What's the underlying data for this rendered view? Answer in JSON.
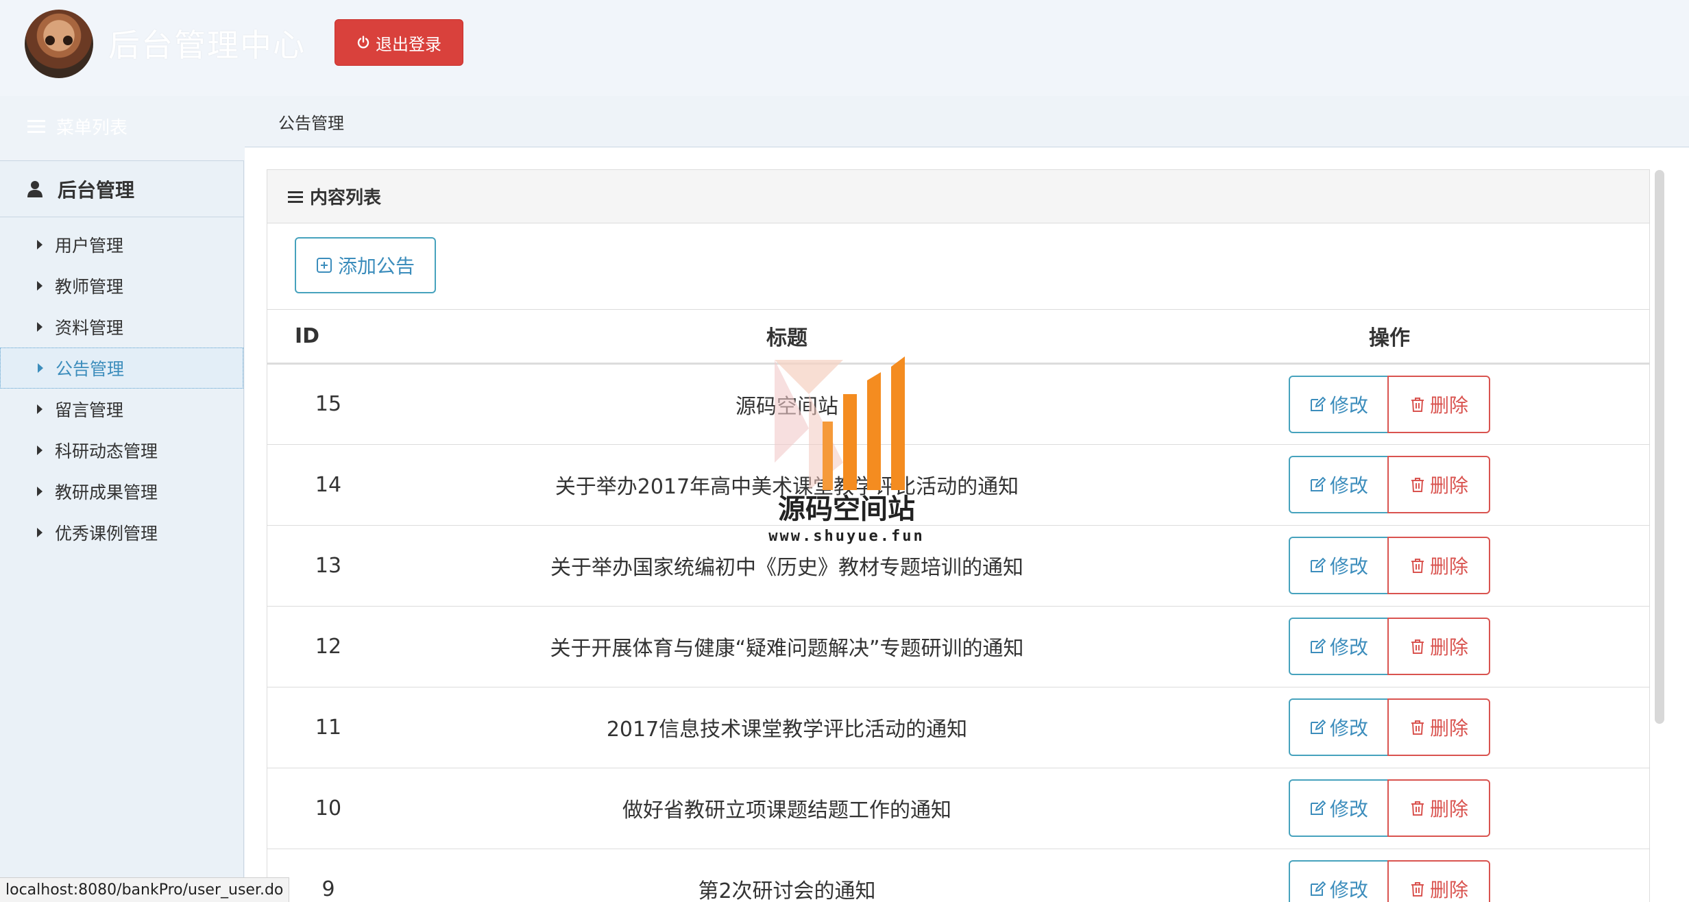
{
  "header": {
    "app_title": "后台管理中心",
    "logout_label": "退出登录",
    "menu_list_label": "菜单列表",
    "breadcrumb": "公告管理"
  },
  "sidebar": {
    "section_title": "后台管理",
    "items": [
      {
        "label": "用户管理",
        "active": false
      },
      {
        "label": "教师管理",
        "active": false
      },
      {
        "label": "资料管理",
        "active": false
      },
      {
        "label": "公告管理",
        "active": true
      },
      {
        "label": "留言管理",
        "active": false
      },
      {
        "label": " 科研动态管理",
        "active": false
      },
      {
        "label": "教研成果管理",
        "active": false
      },
      {
        "label": "优秀课例管理",
        "active": false
      }
    ]
  },
  "panel": {
    "heading": "内容列表",
    "add_label": "添加公告",
    "columns": [
      "ID",
      "标题",
      "操作"
    ],
    "edit_label": "修改",
    "delete_label": "删除",
    "rows": [
      {
        "id": "15",
        "title": "源码空间站"
      },
      {
        "id": "14",
        "title": "关于举办2017年高中美术课堂教学评比活动的通知"
      },
      {
        "id": "13",
        "title": "关于举办国家统编初中《历史》教材专题培训的通知"
      },
      {
        "id": "12",
        "title": "关于开展体育与健康“疑难问题解决”专题研训的通知"
      },
      {
        "id": "11",
        "title": "2017信息技术课堂教学评比活动的通知"
      },
      {
        "id": "10",
        "title": "做好省教研立项课题结题工作的通知"
      },
      {
        "id": "9",
        "title": "第2次研讨会的通知"
      }
    ]
  },
  "watermark": {
    "name": "源码空间站",
    "url": "www.shuyue.fun"
  },
  "status_bar": {
    "url": "localhost:8080/bankPro/user_user.do"
  },
  "colors": {
    "danger": "#d9413c",
    "primary": "#3c8dbc"
  }
}
